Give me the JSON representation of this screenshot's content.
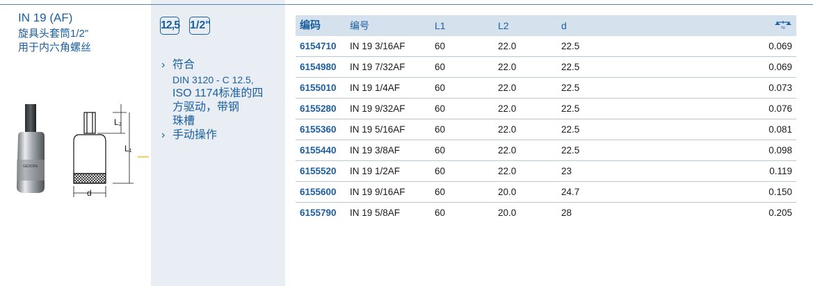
{
  "header": {
    "title": "IN 19 (AF)",
    "subtitle_line1": "旋具头套筒1/2\"",
    "subtitle_line2": "用于内六角螺丝"
  },
  "badges": {
    "drive_size": "12,5",
    "drive_inch": "1/2\""
  },
  "drawing_labels": {
    "l2": "L₂",
    "l1": "L₁",
    "d": "d"
  },
  "features": [
    {
      "chevron": "›",
      "heading": "符合",
      "sub1": "DIN 3120 - C 12.5,",
      "sub2": "ISO 1174标准的四",
      "sub3": "方驱动，带钢",
      "sub4": "珠槽"
    },
    {
      "chevron": "›",
      "heading": "手动操作"
    }
  ],
  "table": {
    "headers": {
      "code": "编码",
      "name": "编号",
      "l1": "L1",
      "l2": "L2",
      "d": "d",
      "weight_icon": "scale-kg-icon"
    },
    "rows": [
      {
        "code": "6154710",
        "name": "IN 19 3/16AF",
        "l1": "60",
        "l2": "22.0",
        "d": "22.5",
        "w": "0.069"
      },
      {
        "code": "6154980",
        "name": "IN 19 7/32AF",
        "l1": "60",
        "l2": "22.0",
        "d": "22.5",
        "w": "0.069"
      },
      {
        "code": "6155010",
        "name": "IN 19 1/4AF",
        "l1": "60",
        "l2": "22.0",
        "d": "22.5",
        "w": "0.073"
      },
      {
        "code": "6155280",
        "name": "IN 19 9/32AF",
        "l1": "60",
        "l2": "22.0",
        "d": "22.5",
        "w": "0.076"
      },
      {
        "code": "6155360",
        "name": "IN 19 5/16AF",
        "l1": "60",
        "l2": "22.0",
        "d": "22.5",
        "w": "0.081"
      },
      {
        "code": "6155440",
        "name": "IN 19 3/8AF",
        "l1": "60",
        "l2": "22.0",
        "d": "22.5",
        "w": "0.098"
      },
      {
        "code": "6155520",
        "name": "IN 19 1/2AF",
        "l1": "60",
        "l2": "22.0",
        "d": "23",
        "w": "0.119"
      },
      {
        "code": "6155600",
        "name": "IN 19 9/16AF",
        "l1": "60",
        "l2": "20.0",
        "d": "24.7",
        "w": "0.150"
      },
      {
        "code": "6155790",
        "name": "IN 19 5/8AF",
        "l1": "60",
        "l2": "20.0",
        "d": "28",
        "w": "0.205"
      }
    ]
  },
  "colors": {
    "brand_blue": "#1b5fa0",
    "panel_bg": "#e9eef5",
    "header_bg": "#d6e1ee"
  }
}
